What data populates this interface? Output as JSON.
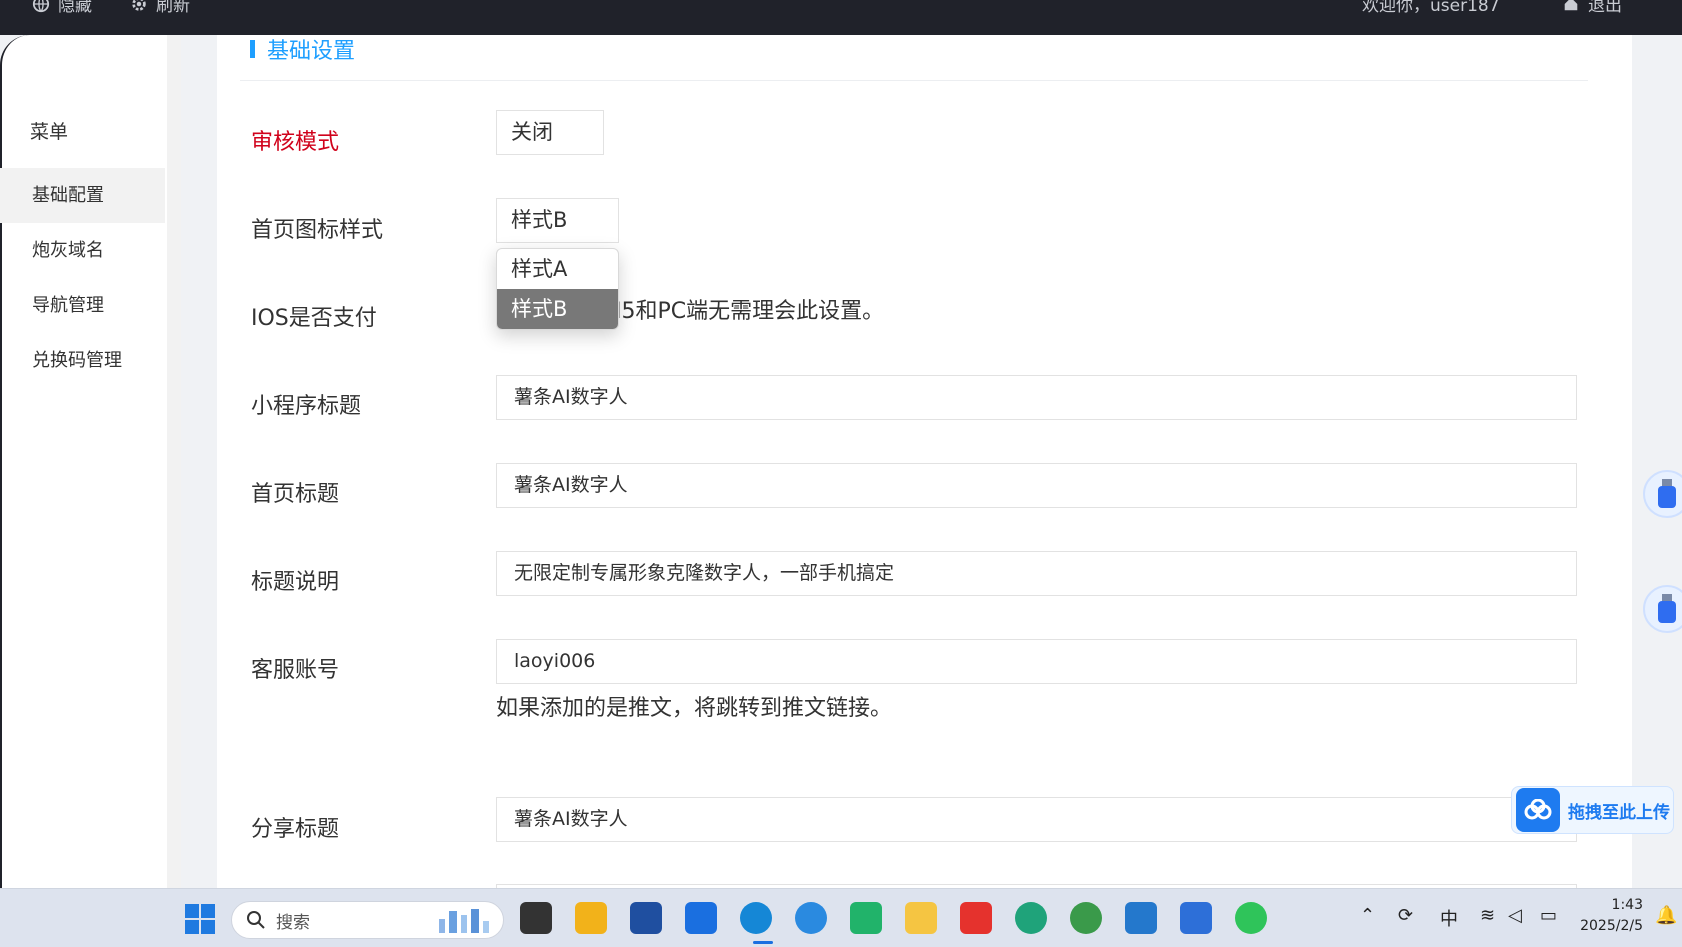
{
  "topbar": {
    "hide_label": "隐藏",
    "refresh_label": "刷新",
    "welcome": "欢迎你，user187",
    "logout_label": "退出"
  },
  "sidebar": {
    "menu_title": "菜单",
    "items": [
      {
        "label": "基础配置",
        "active": true
      },
      {
        "label": "炮灰域名",
        "active": false
      },
      {
        "label": "导航管理",
        "active": false
      },
      {
        "label": "兑换码管理",
        "active": false
      }
    ]
  },
  "section": {
    "title": "基础设置"
  },
  "form": {
    "review_mode": {
      "label": "审核模式",
      "value": "关闭"
    },
    "icon_style": {
      "label": "首页图标样式",
      "value": "样式B",
      "options": [
        "样式A",
        "样式B"
      ]
    },
    "ios_pay": {
      "label": "IOS是否支付",
      "tip": "H5和PC端无需理会此设置。"
    },
    "mini_title": {
      "label": "小程序标题",
      "value": "薯条AI数字人"
    },
    "home_title": {
      "label": "首页标题",
      "value": "薯条AI数字人"
    },
    "title_desc": {
      "label": "标题说明",
      "value": "无限定制专属形象克隆数字人，一部手机搞定"
    },
    "service_account": {
      "label": "客服账号",
      "value": "laoyi006",
      "tip": "如果添加的是推文，将跳转到推文链接。"
    },
    "share_title": {
      "label": "分享标题",
      "value": "薯条AI数字人"
    }
  },
  "upload_widget": {
    "label": "拖拽至此上传"
  },
  "taskbar": {
    "search_placeholder": "搜索",
    "ime": "中",
    "time": "1:43",
    "date": "2025/2/5"
  },
  "colors": {
    "accent": "#1e9fff",
    "required_label": "#d0021b",
    "topbar": "#20222a",
    "dropdown_selected": "#787878"
  }
}
